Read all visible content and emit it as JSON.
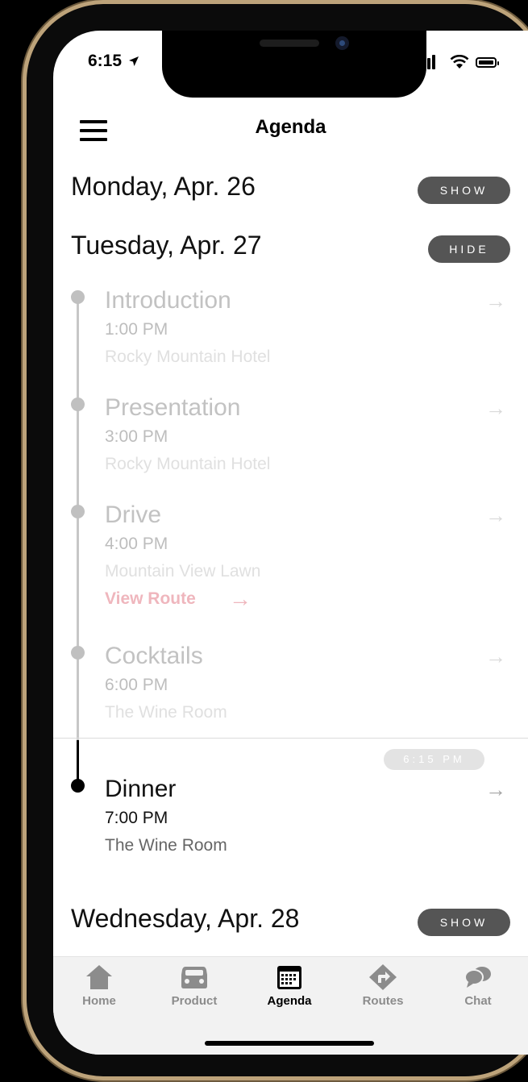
{
  "status_bar": {
    "time": "6:15"
  },
  "header": {
    "title": "Agenda"
  },
  "days": {
    "monday": {
      "label": "Monday, Apr. 26",
      "toggle": "SHOW"
    },
    "tuesday": {
      "label": "Tuesday, Apr. 27",
      "toggle": "HIDE"
    },
    "wednesday": {
      "label": "Wednesday, Apr. 28",
      "toggle": "SHOW"
    }
  },
  "events": [
    {
      "title": "Introduction",
      "time": "1:00 PM",
      "location": "Rocky Mountain Hotel"
    },
    {
      "title": "Presentation",
      "time": "3:00 PM",
      "location": "Rocky Mountain Hotel"
    },
    {
      "title": "Drive",
      "time": "4:00 PM",
      "location": "Mountain View Lawn",
      "link": "View Route"
    },
    {
      "title": "Cocktails",
      "time": "6:00 PM",
      "location": "The Wine Room"
    },
    {
      "title": "Dinner",
      "time": "7:00 PM",
      "location": "The Wine Room"
    }
  ],
  "now_indicator": "6:15 PM",
  "tabs": [
    {
      "label": "Home",
      "icon": "home-icon"
    },
    {
      "label": "Product",
      "icon": "car-icon"
    },
    {
      "label": "Agenda",
      "icon": "calendar-icon",
      "active": true
    },
    {
      "label": "Routes",
      "icon": "route-icon"
    },
    {
      "label": "Chat",
      "icon": "chat-icon"
    }
  ],
  "colors": {
    "accent": "#efb6bd",
    "pill": "#555555",
    "inactive": "#8c8c8c"
  }
}
